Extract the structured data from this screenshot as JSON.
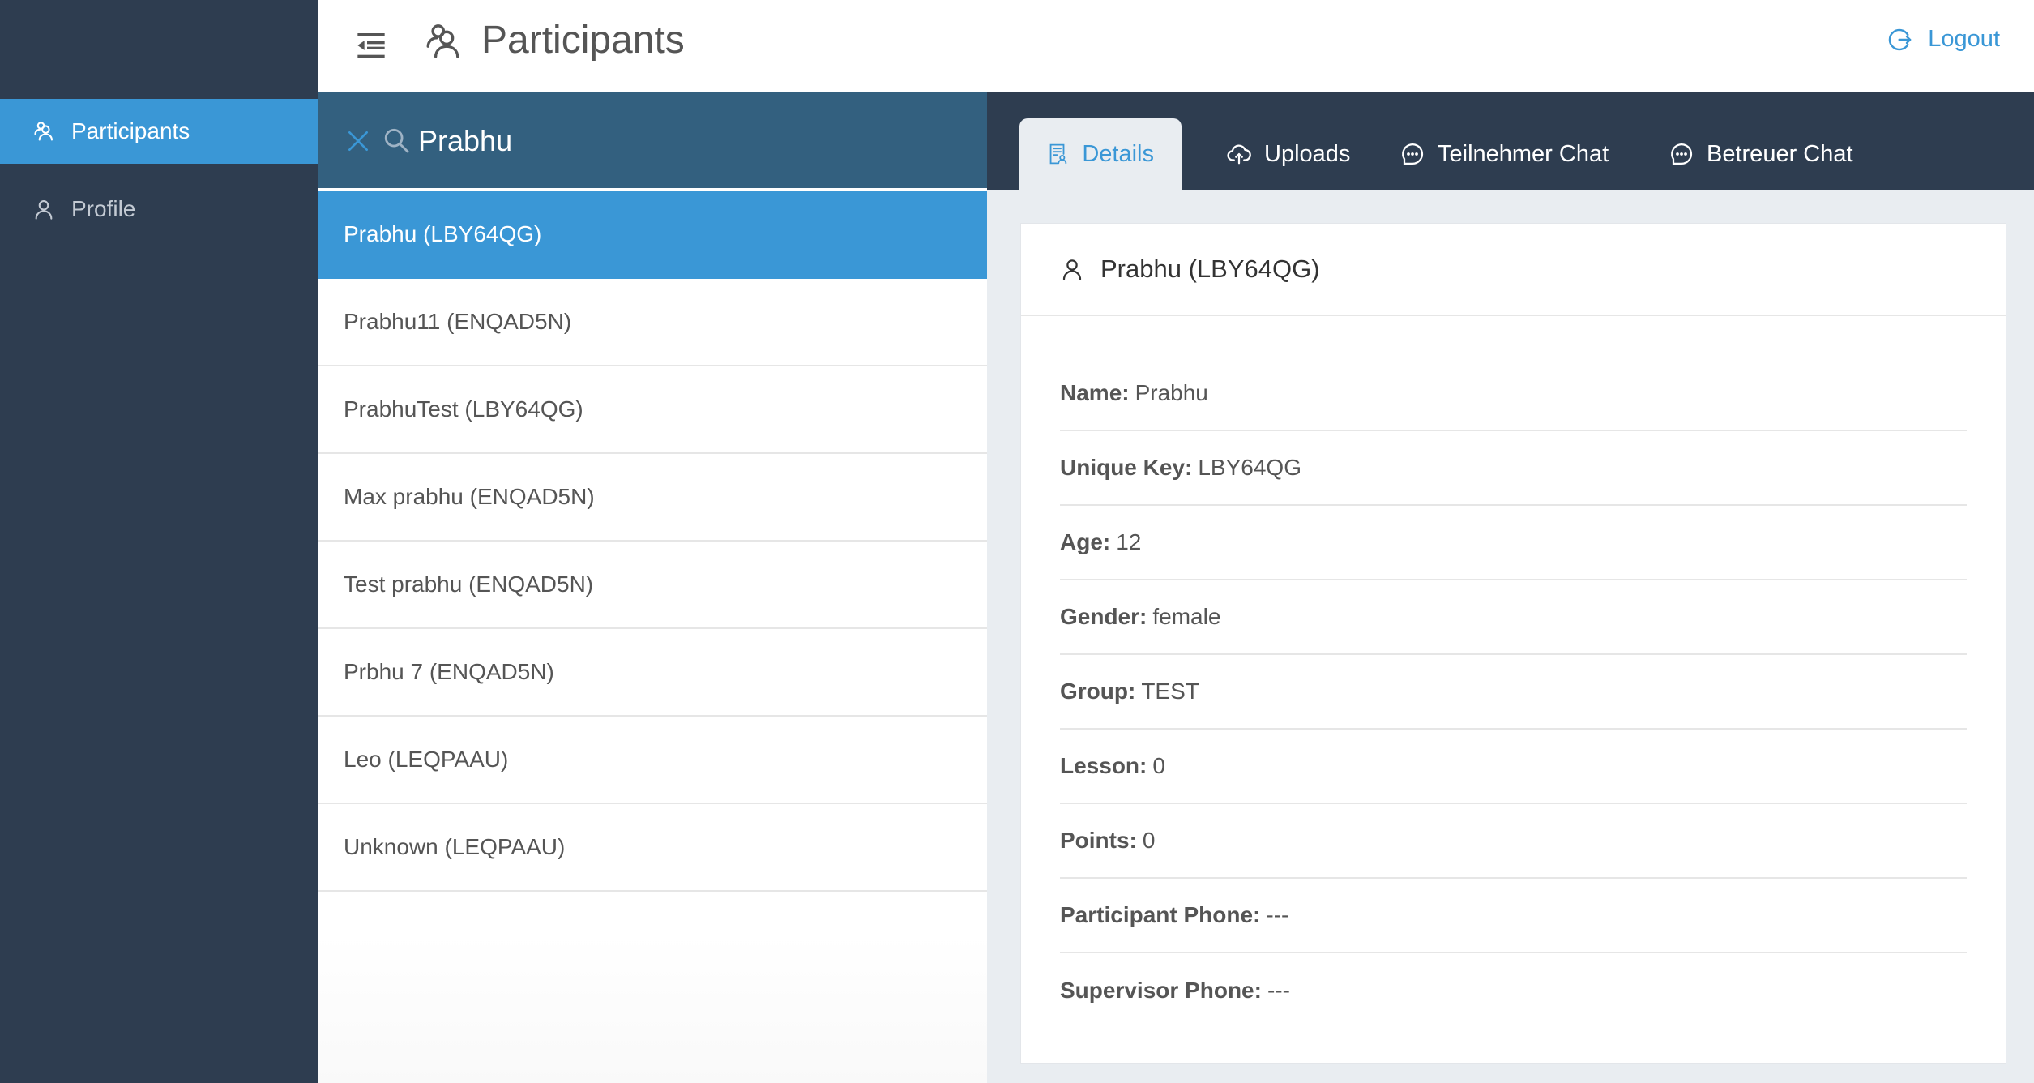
{
  "sidebar": {
    "items": [
      {
        "label": "Participants",
        "icon": "users-icon",
        "active": true
      },
      {
        "label": "Profile",
        "icon": "user-icon",
        "active": false
      }
    ]
  },
  "header": {
    "title": "Participants",
    "logout_label": "Logout"
  },
  "search": {
    "value": "Prabhu",
    "placeholder": ""
  },
  "participants": [
    {
      "label": "Prabhu (LBY64QG)",
      "active": true
    },
    {
      "label": "Prabhu11 (ENQAD5N)",
      "active": false
    },
    {
      "label": "PrabhuTest (LBY64QG)",
      "active": false
    },
    {
      "label": "Max prabhu (ENQAD5N)",
      "active": false
    },
    {
      "label": "Test prabhu (ENQAD5N)",
      "active": false
    },
    {
      "label": "Prbhu 7 (ENQAD5N)",
      "active": false
    },
    {
      "label": "Leo (LEQPAAU)",
      "active": false
    },
    {
      "label": "Unknown (LEQPAAU)",
      "active": false
    }
  ],
  "tabs": [
    {
      "label": "Details",
      "icon": "document-user-icon",
      "active": true
    },
    {
      "label": "Uploads",
      "icon": "cloud-upload-icon",
      "active": false
    },
    {
      "label": "Teilnehmer Chat",
      "icon": "chat-bubble-icon",
      "active": false
    },
    {
      "label": "Betreuer Chat",
      "icon": "chat-bubble-icon",
      "active": false
    }
  ],
  "details": {
    "title": "Prabhu (LBY64QG)",
    "fields": [
      {
        "label": "Name:",
        "value": "Prabhu"
      },
      {
        "label": "Unique Key:",
        "value": "LBY64QG"
      },
      {
        "label": "Age:",
        "value": "12"
      },
      {
        "label": "Gender:",
        "value": "female"
      },
      {
        "label": "Group:",
        "value": "TEST"
      },
      {
        "label": "Lesson:",
        "value": "0"
      },
      {
        "label": "Points:",
        "value": "0"
      },
      {
        "label": "Participant Phone:",
        "value": "---"
      },
      {
        "label": "Supervisor Phone:",
        "value": "---"
      }
    ]
  },
  "colors": {
    "sidebar_bg": "#2e3d50",
    "accent": "#3a97d6",
    "search_bg": "#33607f",
    "content_bg": "#e9edf1"
  }
}
